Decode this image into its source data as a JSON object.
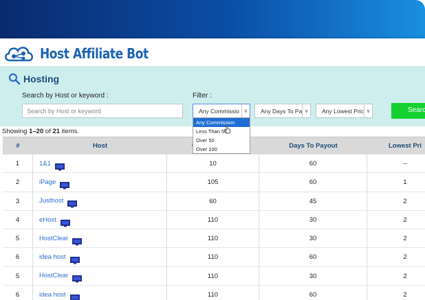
{
  "brand": {
    "name": "Host Affiliate Bot"
  },
  "panel": {
    "title": "Hosting",
    "search_label": "Search by Host or keyword :",
    "search_placeholder": "Search by Host or keyword",
    "filter_label": "Filter :",
    "filters": [
      "Any Commissio",
      "Any Days To Pa",
      "Any Lowest Pric"
    ],
    "search_button": "Searc"
  },
  "dropdown": {
    "options": [
      "Any Commission",
      "Less Than 50",
      "Over 50",
      "Over 100"
    ],
    "selected_index": 0
  },
  "summary": {
    "prefix": "Showing ",
    "range": "1–20",
    "mid": " of ",
    "total": "21",
    "suffix": " items."
  },
  "table": {
    "headers": [
      "#",
      "Host",
      "C",
      "Days To Payout",
      "Lowest Pri"
    ],
    "rows": [
      {
        "num": "1",
        "host": "1&1",
        "commission": "10",
        "days": "60",
        "lowest": "--"
      },
      {
        "num": "2",
        "host": "iPage",
        "commission": "105",
        "days": "60",
        "lowest": "1"
      },
      {
        "num": "3",
        "host": "Justhost",
        "commission": "60",
        "days": "45",
        "lowest": "2"
      },
      {
        "num": "4",
        "host": "eHost",
        "commission": "110",
        "days": "30",
        "lowest": "2"
      },
      {
        "num": "5",
        "host": "HostClear",
        "commission": "110",
        "days": "30",
        "lowest": "2"
      },
      {
        "num": "6",
        "host": "idea host",
        "commission": "110",
        "days": "60",
        "lowest": "2"
      },
      {
        "num": "5",
        "host": "HostClear",
        "commission": "110",
        "days": "30",
        "lowest": "2"
      },
      {
        "num": "6",
        "host": "idea host",
        "commission": "110",
        "days": "60",
        "lowest": "2"
      }
    ]
  },
  "colors": {
    "accent": "#1c63b4",
    "panel_bg": "#cdeeed",
    "search_button": "#14d12f",
    "link": "#2c6dd1"
  }
}
